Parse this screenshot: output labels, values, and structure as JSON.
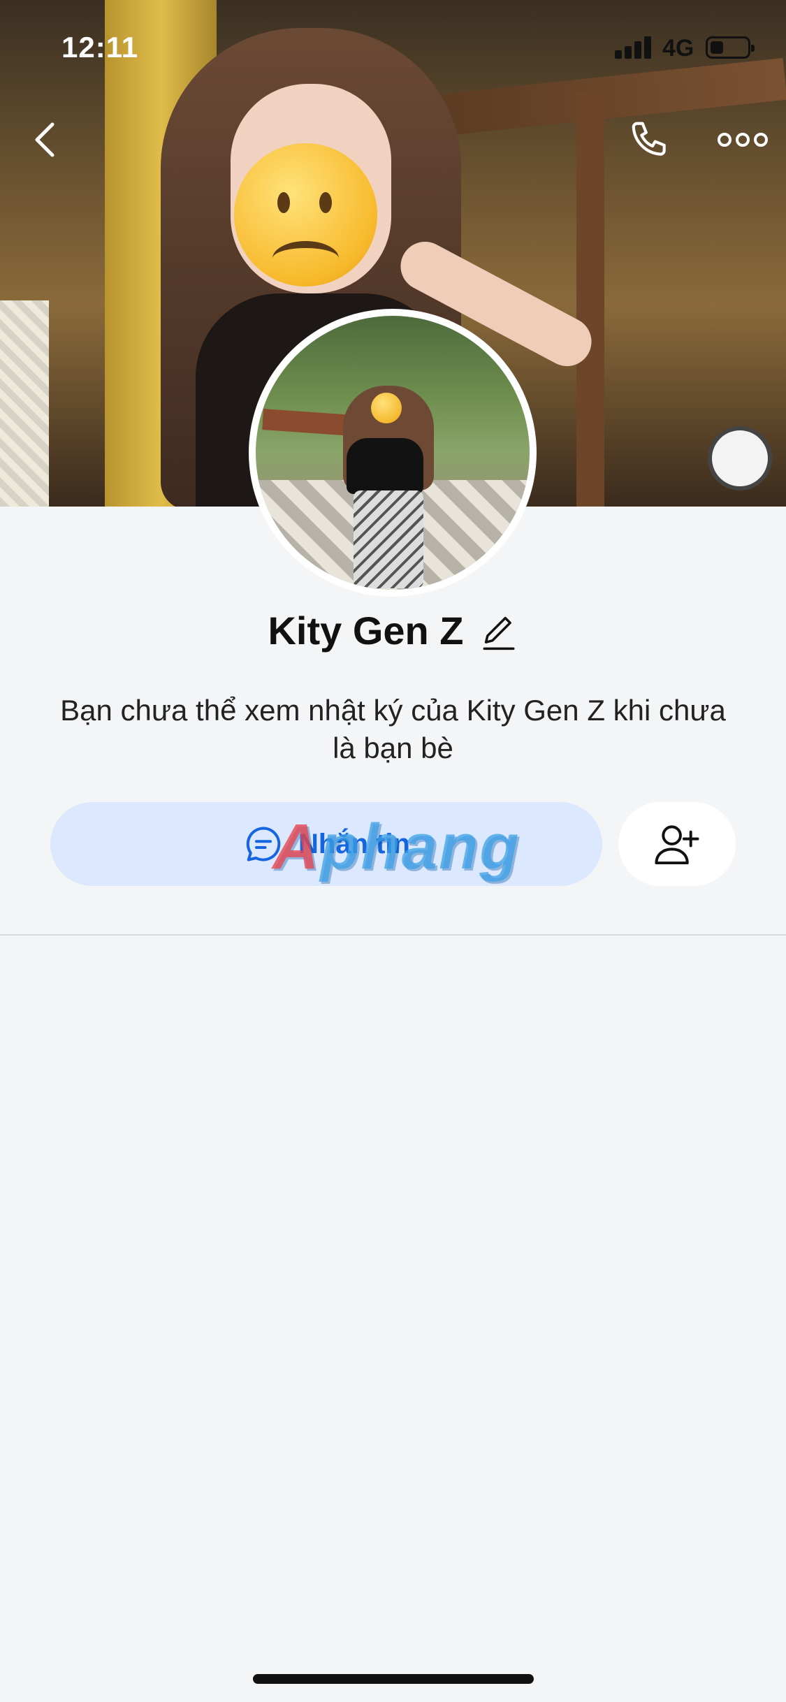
{
  "status_bar": {
    "time": "12:11",
    "network": "4G",
    "signal_icon": "signal-bars-icon",
    "battery_level": 0.35
  },
  "header": {
    "back_icon": "chevron-left-icon",
    "call_icon": "phone-icon",
    "more_icon": "more-horizontal-icon"
  },
  "profile": {
    "name": "Kity Gen Z",
    "edit_icon": "pencil-icon",
    "description": "Bạn chưa thể xem nhật ký của Kity Gen Z khi chưa là bạn bè"
  },
  "actions": {
    "message_label": "Nhắn tin",
    "message_icon": "chat-bubble-icon",
    "add_friend_icon": "add-user-icon"
  },
  "watermark": {
    "part1": "A",
    "part2": "phang"
  },
  "colors": {
    "accent": "#1565e0",
    "message_button_bg": "#dbe8fd",
    "page_bg": "#f4f5f7"
  }
}
